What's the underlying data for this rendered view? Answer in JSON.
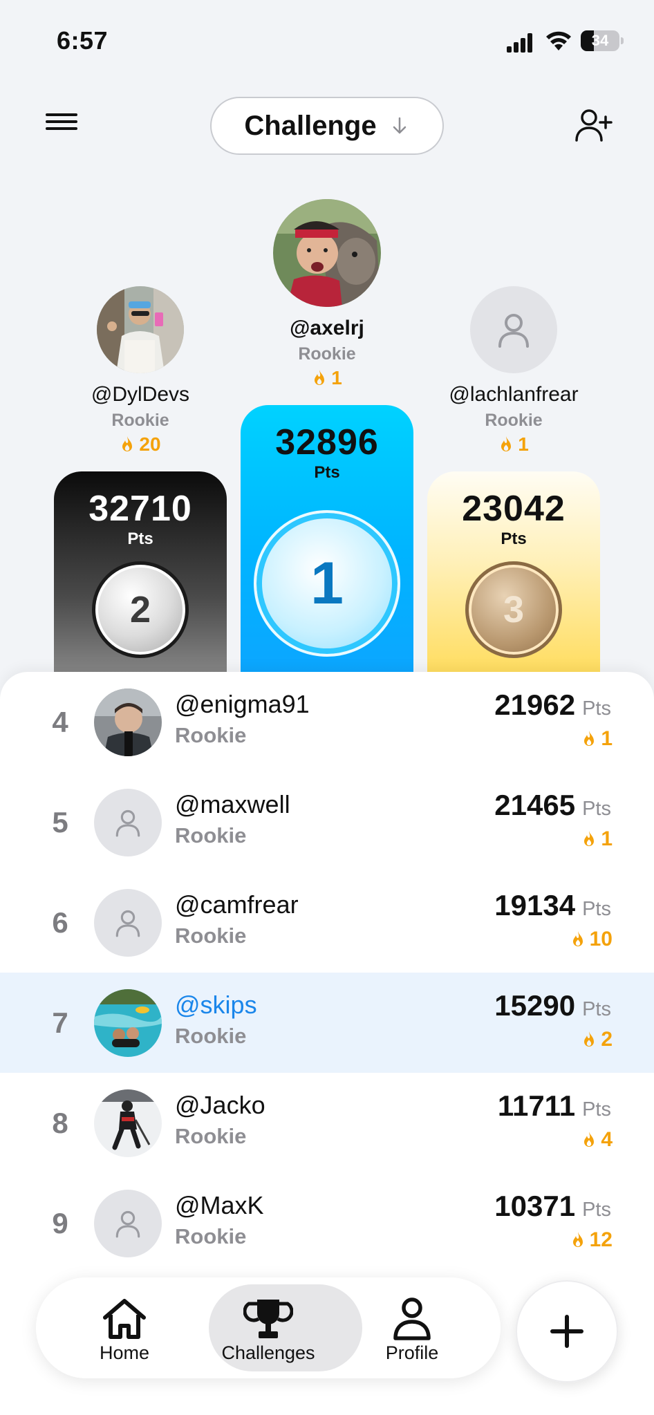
{
  "status_bar": {
    "time": "6:57",
    "battery_level": 34,
    "battery_text": "34"
  },
  "header": {
    "title": "Challenge",
    "menu_icon": "hamburger-icon",
    "dropdown_icon": "arrow-down-icon",
    "add_icon": "add-friend-icon"
  },
  "podium": [
    {
      "place": 2,
      "handle": "@DylDevs",
      "rank_label": "Rookie",
      "streak": "20",
      "score": "32710",
      "pts_label": "Pts",
      "medal": "2"
    },
    {
      "place": 1,
      "handle": "@axelrj",
      "rank_label": "Rookie",
      "streak": "1",
      "score": "32896",
      "pts_label": "Pts",
      "medal": "1"
    },
    {
      "place": 3,
      "handle": "@lachlanfrear",
      "rank_label": "Rookie",
      "streak": "1",
      "score": "23042",
      "pts_label": "Pts",
      "medal": "3"
    }
  ],
  "rows": [
    {
      "rank": "4",
      "handle": "@enigma91",
      "rank_label": "Rookie",
      "score": "21962",
      "pts_label": "Pts",
      "streak": "1",
      "avatar": "photo"
    },
    {
      "rank": "5",
      "handle": "@maxwell",
      "rank_label": "Rookie",
      "score": "21465",
      "pts_label": "Pts",
      "streak": "1",
      "avatar": "placeholder"
    },
    {
      "rank": "6",
      "handle": "@camfrear",
      "rank_label": "Rookie",
      "score": "19134",
      "pts_label": "Pts",
      "streak": "10",
      "avatar": "placeholder"
    },
    {
      "rank": "7",
      "handle": "@skips",
      "rank_label": "Rookie",
      "score": "15290",
      "pts_label": "Pts",
      "streak": "2",
      "avatar": "photo",
      "is_current_user": true
    },
    {
      "rank": "8",
      "handle": "@Jacko",
      "rank_label": "Rookie",
      "score": "11711",
      "pts_label": "Pts",
      "streak": "4",
      "avatar": "photo"
    },
    {
      "rank": "9",
      "handle": "@MaxK",
      "rank_label": "Rookie",
      "score": "10371",
      "pts_label": "Pts",
      "streak": "12",
      "avatar": "placeholder"
    }
  ],
  "tab_bar": [
    {
      "label": "Home",
      "icon": "home-icon"
    },
    {
      "label": "Challenges",
      "icon": "trophy-icon",
      "active": true
    },
    {
      "label": "Profile",
      "icon": "person-icon"
    }
  ],
  "fab": {
    "icon": "plus-icon"
  },
  "colors": {
    "streak": "#f4a20b",
    "current_user": "#1a86ea",
    "first_place": "#00b4ff",
    "third_place": "#ffd84a"
  }
}
